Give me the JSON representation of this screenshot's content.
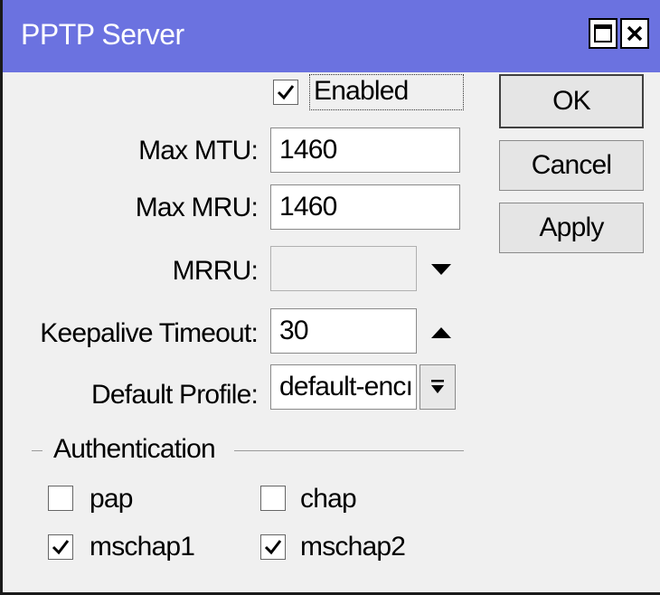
{
  "window": {
    "title": "PPTP Server"
  },
  "form": {
    "enabled": {
      "label": "Enabled",
      "checked": true
    },
    "max_mtu": {
      "label": "Max MTU:",
      "value": "1460"
    },
    "max_mru": {
      "label": "Max MRU:",
      "value": "1460"
    },
    "mrru": {
      "label": "MRRU:",
      "value": ""
    },
    "keepalive": {
      "label": "Keepalive Timeout:",
      "value": "30"
    },
    "default_profile": {
      "label": "Default Profile:",
      "value": "default-encı"
    }
  },
  "authentication": {
    "title": "Authentication",
    "options": [
      {
        "label": "pap",
        "checked": false
      },
      {
        "label": "chap",
        "checked": false
      },
      {
        "label": "mschap1",
        "checked": true
      },
      {
        "label": "mschap2",
        "checked": true
      }
    ]
  },
  "buttons": {
    "ok": "OK",
    "cancel": "Cancel",
    "apply": "Apply"
  }
}
